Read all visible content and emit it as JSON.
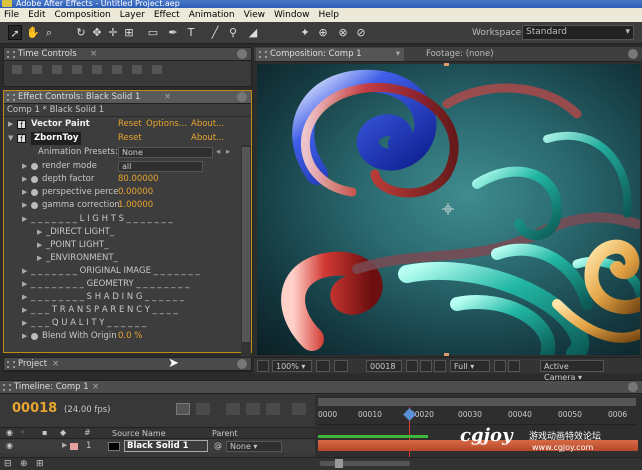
{
  "window": {
    "title": "Adobe After Effects - Untitled Project.aep"
  },
  "menu": [
    "File",
    "Edit",
    "Composition",
    "Layer",
    "Effect",
    "Animation",
    "View",
    "Window",
    "Help"
  ],
  "toolbar": {
    "workspace_label": "Workspace:",
    "workspace_value": "Standard"
  },
  "time_controls": {
    "tab": "Time Controls"
  },
  "effect_controls": {
    "tab": "Effect Controls: Black Solid 1",
    "header": "Comp 1 * Black Solid 1",
    "effects": [
      {
        "name": "Vector Paint",
        "reset": "Reset",
        "options": "Options...",
        "about": "About..."
      },
      {
        "name": "ZbornToy",
        "reset": "Reset",
        "about": "About..."
      }
    ],
    "animation_presets_label": "Animation Presets:",
    "animation_presets_value": "None",
    "params": [
      {
        "label": "render mode",
        "value": "all"
      },
      {
        "label": "depth factor",
        "value": "80.00000"
      },
      {
        "label": "perspective perce",
        "value": "0.00000"
      },
      {
        "label": "gamma correction",
        "value": "1.00000"
      }
    ],
    "groups": [
      "_ _ _ _ _ _ _ L I G H T S _ _ _ _ _ _ _",
      "_DIRECT LIGHT_",
      "_POINT LIGHT_",
      "_ENVIRONMENT_",
      "_ _ _ _ _ _ _ ORIGINAL IMAGE _ _ _ _ _ _ _",
      "_ _ _ _ _ _ _ _ GEOMETRY _ _ _ _ _ _ _ _",
      "_ _ _ _ _ _ _ _ S H A D I N G _ _ _ _ _ _",
      "_ _ _ T R A N S P A R E N C Y _ _ _ _",
      "_ _ _ Q U A L I T Y _ _ _ _ _ _"
    ],
    "blend_label": "Blend With Origin",
    "blend_value": "0.0 %"
  },
  "composition": {
    "tab": "Composition: Comp 1",
    "footage_tab": "Footage: (none)",
    "zoom": "100%",
    "timecode": "00018",
    "resolution": "Full",
    "camera": "Active Camera"
  },
  "project": {
    "tab": "Project"
  },
  "timeline": {
    "tab": "Timeline: Comp 1",
    "current_time": "00018",
    "fps": "(24.00 fps)",
    "columns": {
      "source_name": "Source Name",
      "parent": "Parent"
    },
    "ruler": [
      "0000",
      "00010",
      "00020",
      "00030",
      "00040",
      "00050",
      "0006"
    ],
    "layers": [
      {
        "number": "1",
        "name": "Black Solid 1",
        "parent": "None"
      }
    ]
  },
  "watermark": {
    "brand": "cgjoy",
    "tagline": "游戏动画特效论坛",
    "url": "www.cgjoy.com"
  },
  "colors": {
    "accent_orange": "#e8a530",
    "layer_bar": "#c85534",
    "panel_bg": "#3a3a3a"
  }
}
